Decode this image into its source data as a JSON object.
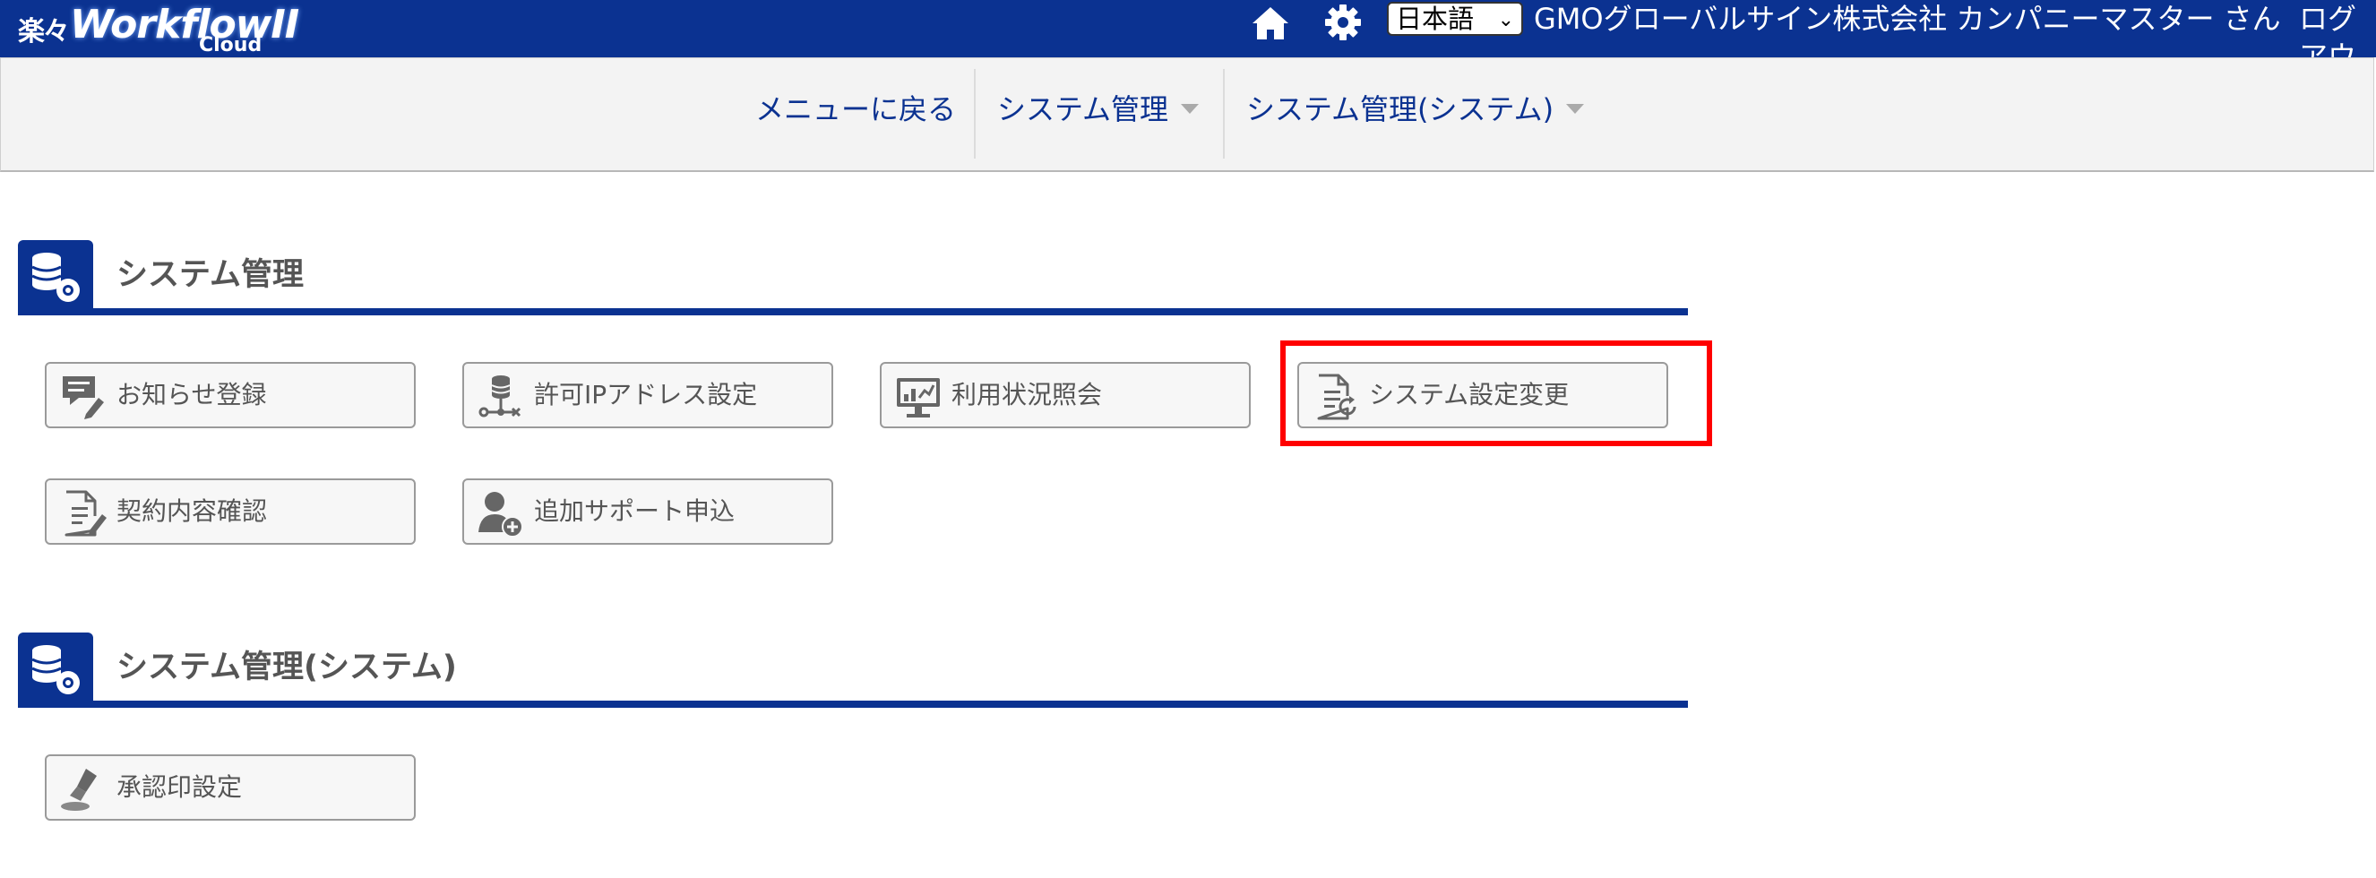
{
  "header": {
    "logo_jp": "楽々",
    "logo_main": "WorkflowII",
    "logo_sub": "Cloud",
    "home_icon": "home-icon",
    "settings_icon": "gear-icon",
    "language": "日本語",
    "user": "GMOグローバルサイン株式会社 カンパニーマスター さん",
    "logout": "ログアウト"
  },
  "subnav": {
    "back": "メニューに戻る",
    "system_admin": "システム管理",
    "system_admin_system": "システム管理(システム)"
  },
  "sections": [
    {
      "title": "システム管理",
      "tiles": [
        {
          "label": "お知らせ登録",
          "icon": "announcement-icon"
        },
        {
          "label": "許可IPアドレス設定",
          "icon": "database-network-icon"
        },
        {
          "label": "利用状況照会",
          "icon": "monitor-chart-icon"
        },
        {
          "label": "システム設定変更",
          "icon": "document-refresh-icon"
        },
        {
          "label": "契約内容確認",
          "icon": "document-edit-icon"
        },
        {
          "label": "追加サポート申込",
          "icon": "user-add-icon"
        }
      ]
    },
    {
      "title": "システム管理(システム)",
      "tiles": [
        {
          "label": "承認印設定",
          "icon": "stamp-icon"
        }
      ]
    }
  ],
  "colors": {
    "brand": "#0b3291",
    "highlight": "#ff0000",
    "tile_bg": "#f7f7f7",
    "text": "#555555"
  }
}
